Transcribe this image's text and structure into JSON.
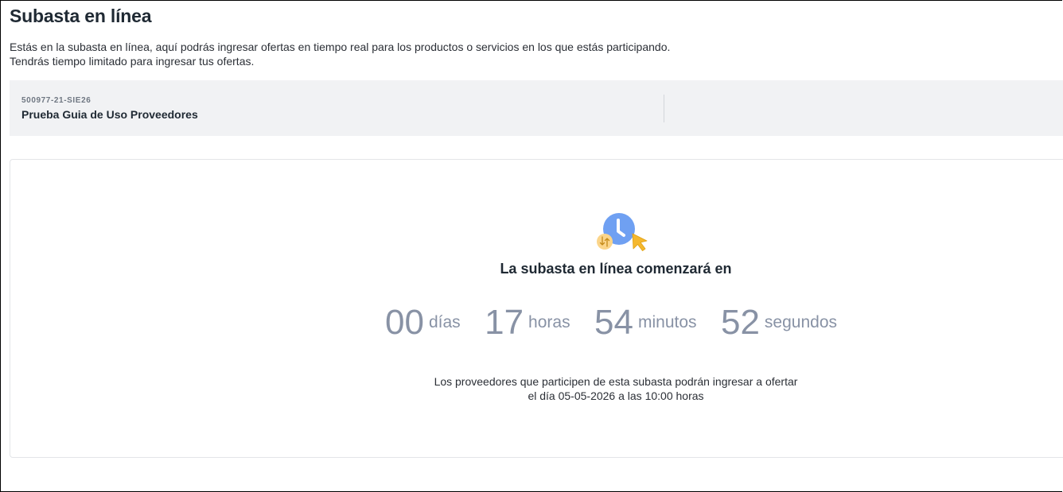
{
  "page": {
    "title": "Subasta en línea",
    "description": "Estás en la subasta en línea, aquí podrás ingresar ofertas en tiempo real para los productos o servicios en los que estás participando. Tendrás tiempo limitado para ingresar tus ofertas."
  },
  "auction": {
    "code": "500977-21-SIE26",
    "name": "Prueba Guia de Uso Proveedores"
  },
  "countdown": {
    "headline": "La subasta en línea comenzará en",
    "days": "00",
    "days_label": "días",
    "hours": "17",
    "hours_label": "horas",
    "minutes": "54",
    "minutes_label": "minutos",
    "seconds": "52",
    "seconds_label": "segundos"
  },
  "notice": {
    "line1": "Los proveedores que participen de esta subasta podrán ingresar a ofertar",
    "line2": "el día 05-05-2026 a las 10:00 horas"
  },
  "icons": {
    "clock": "clock-icon",
    "cursor": "cursor-icon",
    "bid": "bid-arrows-icon"
  },
  "colors": {
    "clock_blue": "#6fa0f2",
    "cursor_yellow": "#f5b82e",
    "bid_circle": "#fbd58a",
    "countdown_gray": "#8892a5",
    "info_bar_bg": "#f1f2f4"
  }
}
